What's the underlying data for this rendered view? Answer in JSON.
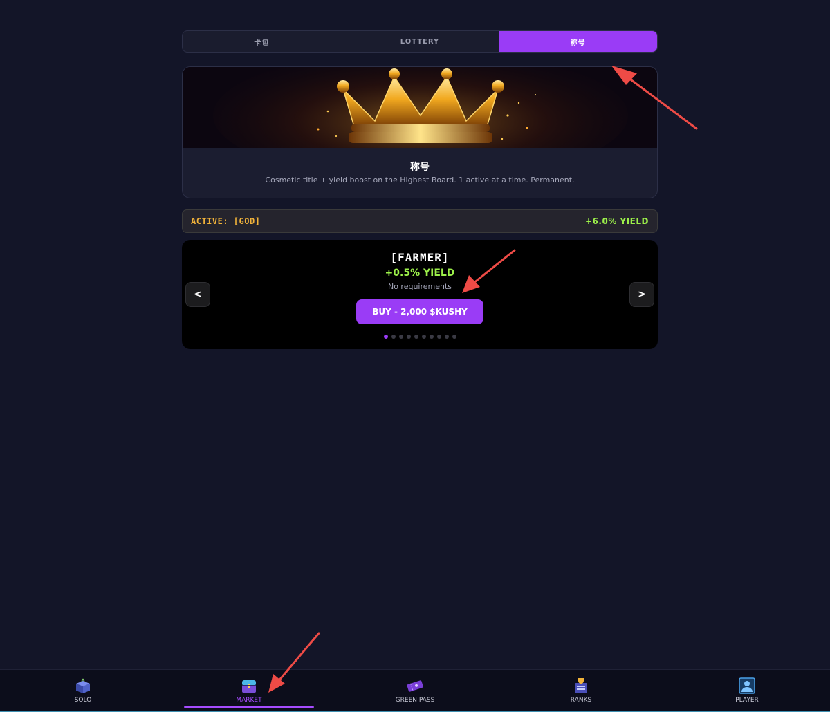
{
  "tabs": [
    {
      "label": "卡包",
      "active": false
    },
    {
      "label": "LOTTERY",
      "active": false
    },
    {
      "label": "称号",
      "active": true
    }
  ],
  "hero": {
    "title": "称号",
    "subtitle": "Cosmetic title + yield boost on the Highest Board. 1 active at a time. Permanent."
  },
  "active_title": {
    "label": "ACTIVE: [GOD]",
    "yield": "+6.0% YIELD"
  },
  "carousel": {
    "title": "[FARMER]",
    "yield": "+0.5% YIELD",
    "requirement": "No requirements",
    "buy_label": "BUY - 2,000 $KUSHY",
    "prev_label": "<",
    "next_label": ">",
    "page_count": 10,
    "current_page": 1
  },
  "bottom_nav": [
    {
      "label": "SOLO",
      "icon": "box-icon",
      "active": false
    },
    {
      "label": "MARKET",
      "icon": "chest-icon",
      "active": true
    },
    {
      "label": "GREEN PASS",
      "icon": "ticket-icon",
      "active": false
    },
    {
      "label": "RANKS",
      "icon": "trophy-board-icon",
      "active": false
    },
    {
      "label": "PLAYER",
      "icon": "player-icon",
      "active": false
    }
  ],
  "colors": {
    "background": "#131528",
    "accent": "#9a3cf6",
    "yield_green": "#9cf04a",
    "active_gold": "#f2b33a",
    "annotation_red": "#ee4b46"
  }
}
